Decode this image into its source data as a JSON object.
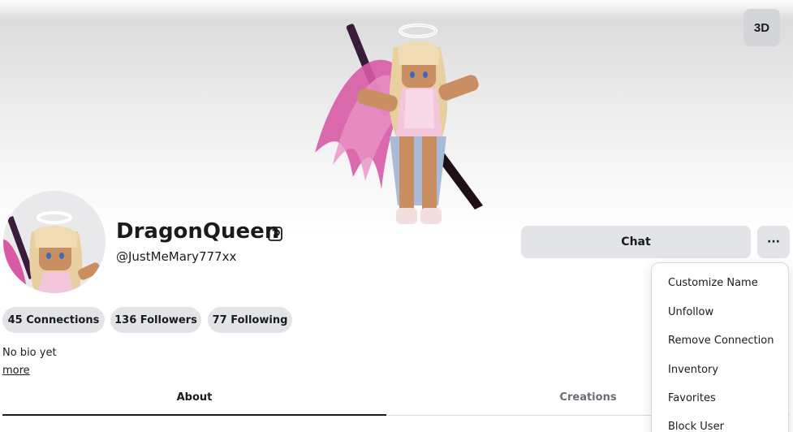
{
  "header": {
    "view_3d_label": "3D"
  },
  "profile": {
    "display_name": "DragonQueen",
    "username": "@JustMeMary777xx",
    "bio": "No bio yet",
    "more_label": "more"
  },
  "actions": {
    "chat_label": "Chat",
    "more_label": "···"
  },
  "stats": [
    {
      "label": "45 Connections"
    },
    {
      "label": "136 Followers"
    },
    {
      "label": "77 Following"
    }
  ],
  "tabs": [
    {
      "label": "About",
      "active": true
    },
    {
      "label": "Creations",
      "active": false
    }
  ],
  "menu": {
    "items": [
      {
        "label": "Customize Name"
      },
      {
        "label": "Unfollow"
      },
      {
        "label": "Remove Connection"
      },
      {
        "label": "Inventory"
      },
      {
        "label": "Favorites"
      },
      {
        "label": "Block User"
      }
    ]
  },
  "colors": {
    "button_bg": "#e3e4e8",
    "text_primary": "#1a1b1e",
    "text_muted": "#6b6d75",
    "wing_pink": "#d85aa6",
    "hair_blonde": "#e8cfa0",
    "skin_tan": "#c98e62"
  },
  "icons": {
    "premium": "premium-badge-icon",
    "more": "ellipsis-icon"
  }
}
